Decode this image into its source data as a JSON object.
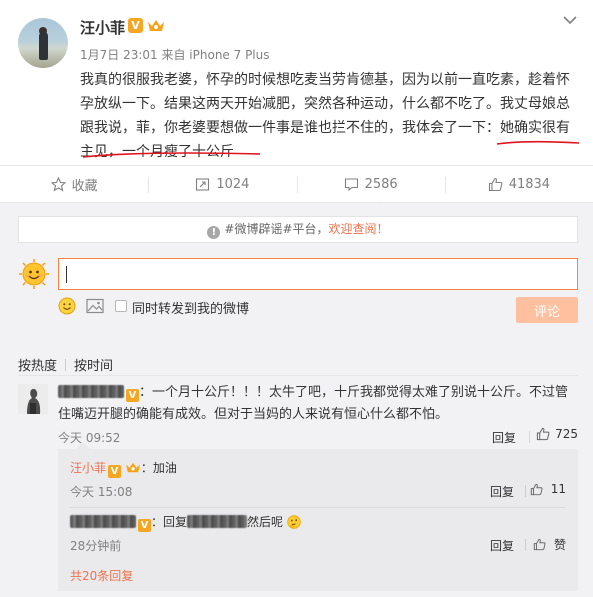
{
  "post": {
    "author": "汪小菲",
    "verified_mark": "V",
    "meta": "1月7日 23:01 来自 iPhone 7 Plus",
    "text": "我真的很服我老婆，怀孕的时候想吃麦当劳肯德基，因为以前一直吃素，趁着怀孕放纵一下。结果这两天开始减肥，突然各种运动，什么都不吃了。我丈母娘总跟我说，菲，你老婆要想做一件事是谁也拦不住的，我体会了一下：她确实很有主见，一个月瘦了十公斤"
  },
  "actions": [
    {
      "icon": "star-icon",
      "label": "收藏"
    },
    {
      "icon": "repost-icon",
      "label": "1024"
    },
    {
      "icon": "comment-icon",
      "label": "2586"
    },
    {
      "icon": "thumbs-up-icon",
      "label": "41834"
    }
  ],
  "notice": {
    "prefix": "#微博辟谣#平台，",
    "highlight": "欢迎查阅！"
  },
  "composer": {
    "repost_label": "同时转发到我的微博",
    "submit_label": "评论"
  },
  "sort": {
    "hot": "按热度",
    "time": "按时间"
  },
  "comment": {
    "verified_mark": "V",
    "text": "：一个月十公斤！！！太牛了吧，十斤我都觉得太难了别说十公斤。不过管住嘴迈开腿的确能有成效。但对于当妈的人来说有恒心什么都不怕。",
    "time": "今天 09:52",
    "reply_label": "回复",
    "likes": "725"
  },
  "replies": [
    {
      "name": "汪小菲",
      "verified_mark": "V",
      "text": "：加油",
      "time": "今天 15:08",
      "reply_label": "回复",
      "likes": "11"
    },
    {
      "verified_mark": "V",
      "prefix": "：回复",
      "text": "然后呢",
      "time": "28分钟前",
      "reply_label": "回复",
      "likes": "赞"
    }
  ],
  "more_replies": "共20条回复",
  "colors": {
    "accent": "#eb7350",
    "underline": "#e0141e",
    "input_border": "#ff8140",
    "submit_bg": "#ffc09f",
    "verified": "#f5a623"
  }
}
